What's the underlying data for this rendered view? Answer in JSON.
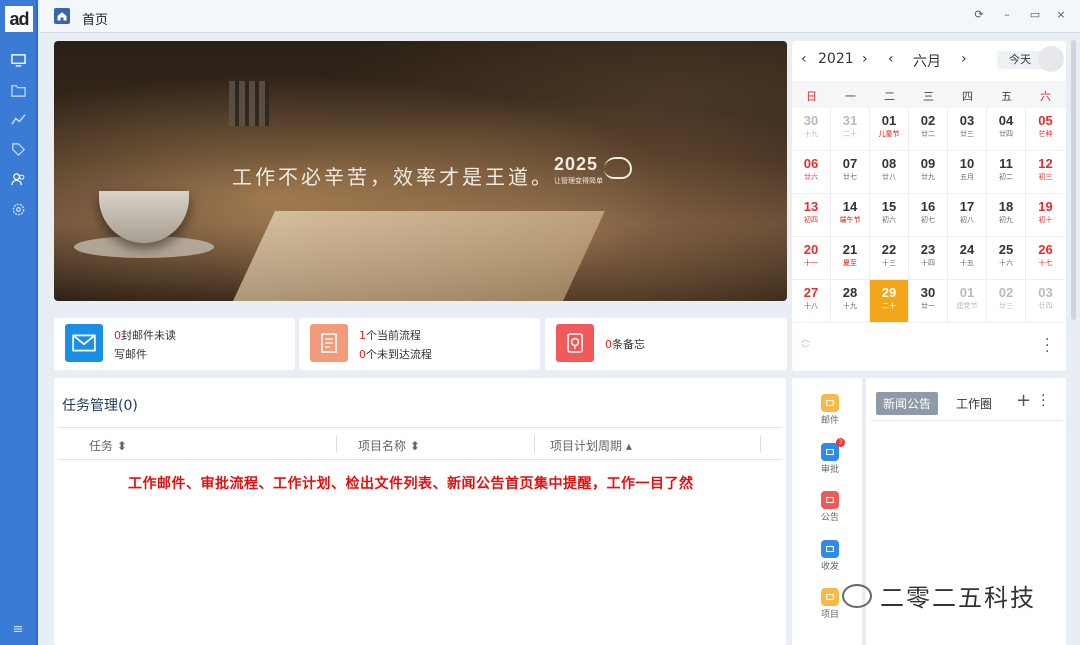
{
  "app": {
    "logo": "ad"
  },
  "sidebar": {
    "items": [
      "monitor-icon",
      "folder-icon",
      "chart-icon",
      "tag-icon",
      "users-icon",
      "gear-icon"
    ],
    "menu_icon": "≡"
  },
  "topbar": {
    "title": "首页",
    "refresh": "⟳",
    "minimize": "–",
    "restore": "▭",
    "close": "×"
  },
  "banner": {
    "slogan": "工作不必辛苦，效率才是王道。",
    "brand_year": "2025",
    "brand_sub": "让管理变得简单"
  },
  "cards": {
    "mail": {
      "count": "0",
      "text": "封邮件未读",
      "action": "写邮件",
      "color": "#1a8fe3"
    },
    "flow": {
      "count1": "1",
      "text1": "个当前流程",
      "count2": "0",
      "text2": "个未到达流程",
      "color": "#f29b7a"
    },
    "memo": {
      "count": "0",
      "text": "条备忘",
      "color": "#f05a5a"
    }
  },
  "tasks": {
    "title": "任务管理(0)",
    "columns": [
      "任务 ⬍",
      "项目名称 ⬍",
      "项目计划周期 ▴"
    ],
    "note": "工作邮件、审批流程、工作计划、检出文件列表、新闻公告首页集中提醒，工作一目了然"
  },
  "calendar": {
    "year": "2021",
    "month": "六月",
    "today_label": "今天",
    "prev": "‹",
    "next": "›",
    "weekdays": [
      "日",
      "一",
      "二",
      "三",
      "四",
      "五",
      "六"
    ],
    "days": [
      {
        "d": "30",
        "l": "十九",
        "muted": true
      },
      {
        "d": "31",
        "l": "二十",
        "muted": true
      },
      {
        "d": "01",
        "l": "儿童节",
        "fest": true
      },
      {
        "d": "02",
        "l": "廿二"
      },
      {
        "d": "03",
        "l": "廿三"
      },
      {
        "d": "04",
        "l": "廿四"
      },
      {
        "d": "05",
        "l": "芒种",
        "wk": true
      },
      {
        "d": "06",
        "l": "廿六",
        "wk": true
      },
      {
        "d": "07",
        "l": "廿七"
      },
      {
        "d": "08",
        "l": "廿八"
      },
      {
        "d": "09",
        "l": "廿九"
      },
      {
        "d": "10",
        "l": "五月"
      },
      {
        "d": "11",
        "l": "初二"
      },
      {
        "d": "12",
        "l": "初三",
        "wk": true
      },
      {
        "d": "13",
        "l": "初四",
        "wk": true
      },
      {
        "d": "14",
        "l": "端午节",
        "fest": true
      },
      {
        "d": "15",
        "l": "初六"
      },
      {
        "d": "16",
        "l": "初七"
      },
      {
        "d": "17",
        "l": "初八"
      },
      {
        "d": "18",
        "l": "初九"
      },
      {
        "d": "19",
        "l": "初十",
        "wk": true
      },
      {
        "d": "20",
        "l": "十一",
        "wk": true
      },
      {
        "d": "21",
        "l": "夏至",
        "fest": true
      },
      {
        "d": "22",
        "l": "十三"
      },
      {
        "d": "23",
        "l": "十四"
      },
      {
        "d": "24",
        "l": "十五"
      },
      {
        "d": "25",
        "l": "十六"
      },
      {
        "d": "26",
        "l": "十七",
        "wk": true
      },
      {
        "d": "27",
        "l": "十八",
        "wk": true
      },
      {
        "d": "28",
        "l": "十九"
      },
      {
        "d": "29",
        "l": "二十",
        "today": true
      },
      {
        "d": "30",
        "l": "廿一"
      },
      {
        "d": "01",
        "l": "建党节",
        "muted": true
      },
      {
        "d": "02",
        "l": "廿三",
        "muted": true
      },
      {
        "d": "03",
        "l": "廿四",
        "muted": true
      }
    ]
  },
  "quick": [
    {
      "label": "邮件",
      "color": "#f6b94a",
      "icon": "mail-icon"
    },
    {
      "label": "审批",
      "color": "#2e8be6",
      "icon": "approve-icon",
      "badge": "3"
    },
    {
      "label": "公告",
      "color": "#f05a5a",
      "icon": "announce-icon"
    },
    {
      "label": "收发",
      "color": "#2e8be6",
      "icon": "exchange-icon"
    },
    {
      "label": "项目",
      "color": "#f6b94a",
      "icon": "project-icon"
    }
  ],
  "news": {
    "tab_active": "新闻公告",
    "tab2": "工作圈",
    "plus": "+"
  },
  "watermark": "二零二五科技"
}
